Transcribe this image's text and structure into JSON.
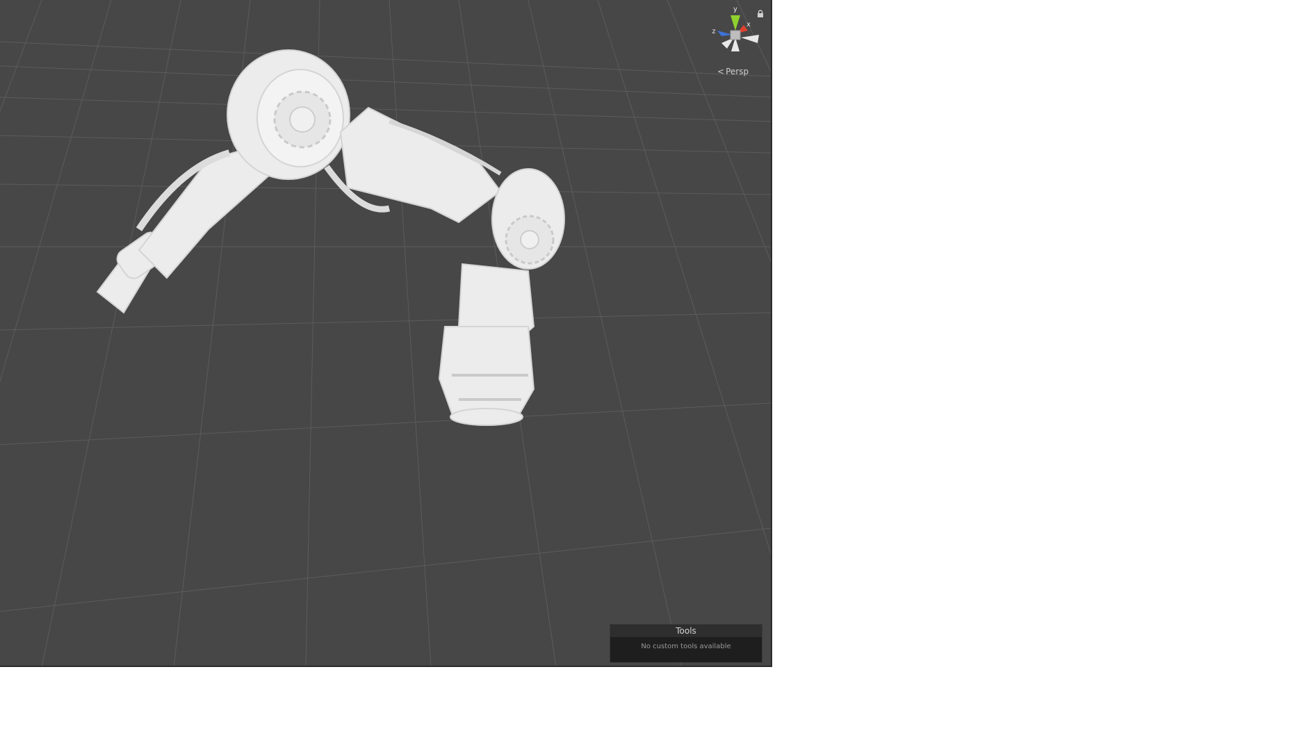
{
  "scene": {
    "view_mode": "Persp",
    "background_color": "#474747",
    "grid_color": "#5a5a5a",
    "model_color": "#ececec",
    "model_name": "robotic-arm"
  },
  "gizmo": {
    "y_label": "y",
    "x_label": "x",
    "z_label": "z",
    "y_color": "#8fd12e",
    "x_color": "#e0412e",
    "z_color": "#3f73d8",
    "icon": "orientation-gizmo-icon"
  },
  "tools_panel": {
    "title": "Tools",
    "message": "No custom tools available"
  }
}
